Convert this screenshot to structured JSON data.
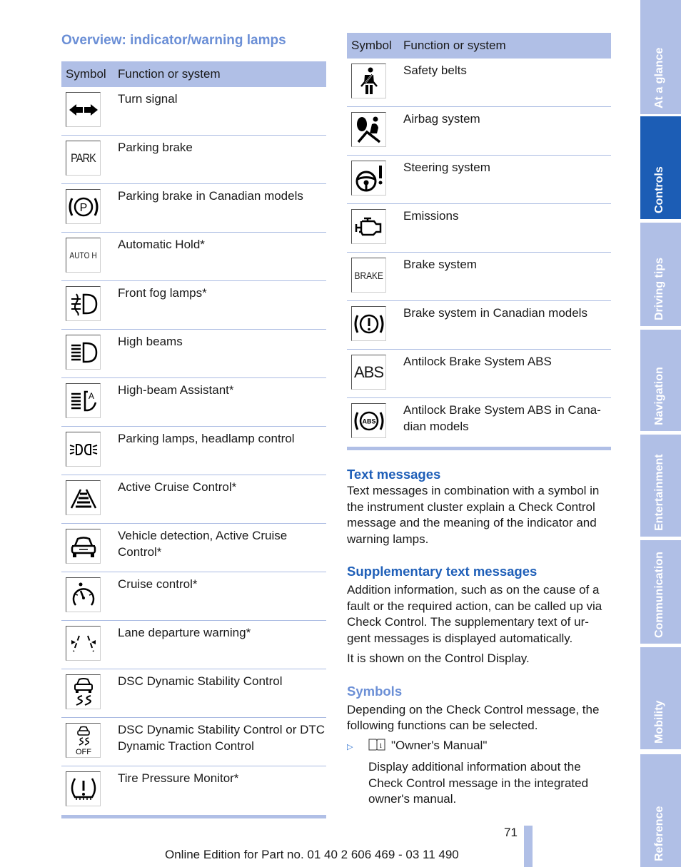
{
  "left_section": {
    "title": "Overview: indicator/warning lamps",
    "table_header": {
      "symbol": "Symbol",
      "function": "Function or system"
    },
    "rows": [
      {
        "icon": "turn-signal-icon",
        "label": "Turn signal"
      },
      {
        "icon": "park-text-icon",
        "icon_text": "PARK",
        "label": "Parking brake"
      },
      {
        "icon": "parking-brake-canada-icon",
        "label": "Parking brake in Canadian models"
      },
      {
        "icon": "auto-hold-icon",
        "icon_text": "AUTO H",
        "label": "Automatic Hold*"
      },
      {
        "icon": "front-fog-lamp-icon",
        "label": "Front fog lamps*"
      },
      {
        "icon": "high-beam-icon",
        "label": "High beams"
      },
      {
        "icon": "high-beam-assistant-icon",
        "label": "High-beam Assistant*"
      },
      {
        "icon": "parking-lamps-icon",
        "label": "Parking lamps, headlamp control"
      },
      {
        "icon": "active-cruise-control-icon",
        "label": "Active Cruise Control*"
      },
      {
        "icon": "vehicle-detection-icon",
        "label": "Vehicle detection, Active Cruise Control*"
      },
      {
        "icon": "cruise-control-icon",
        "label": "Cruise control*"
      },
      {
        "icon": "lane-departure-icon",
        "label": "Lane departure warning*"
      },
      {
        "icon": "dsc-icon",
        "label": "DSC Dynamic Stability Control"
      },
      {
        "icon": "dsc-off-icon",
        "icon_text": "OFF",
        "label": "DSC Dynamic Stability Control or DTC Dynamic Traction Control"
      },
      {
        "icon": "tire-pressure-icon",
        "label": "Tire Pressure Monitor*"
      }
    ]
  },
  "right_section": {
    "table_header": {
      "symbol": "Symbol",
      "function": "Function or system"
    },
    "rows": [
      {
        "icon": "safety-belt-icon",
        "label": "Safety belts"
      },
      {
        "icon": "airbag-icon",
        "label": "Airbag system"
      },
      {
        "icon": "steering-system-icon",
        "label": "Steering system"
      },
      {
        "icon": "emissions-icon",
        "label": "Emissions"
      },
      {
        "icon": "brake-text-icon",
        "icon_text": "BRAKE",
        "label": "Brake system"
      },
      {
        "icon": "brake-canada-icon",
        "label": "Brake system in Canadian models"
      },
      {
        "icon": "abs-text-icon",
        "icon_text": "ABS",
        "label": "Antilock Brake System ABS"
      },
      {
        "icon": "abs-canada-icon",
        "icon_text": "ABS",
        "label": "Antilock Brake System ABS in Cana-dian models"
      }
    ],
    "text_messages": {
      "title": "Text messages",
      "body": "Text messages in combination with a symbol in the instrument cluster explain a Check Control message and the meaning of the indicator and warning lamps."
    },
    "supplementary": {
      "title": "Supplementary text messages",
      "body": "Addition information, such as on the cause of a fault or the required action, can be called up via Check Control. The supplementary text of ur-gent messages is displayed automatically.",
      "body2": "It is shown on the Control Display."
    },
    "symbols": {
      "title": "Symbols",
      "body": "Depending on the Check Control message, the following functions can be selected.",
      "bullet_label": "\"Owner's Manual\"",
      "bullet_icon": "owners-manual-icon",
      "bullet_desc": "Display additional information about the Check Control message in the integrated owner's manual."
    }
  },
  "sidebar": {
    "tabs": [
      {
        "label": "At a glance",
        "active": false
      },
      {
        "label": "Controls",
        "active": true
      },
      {
        "label": "Driving tips",
        "active": false
      },
      {
        "label": "Navigation",
        "active": false
      },
      {
        "label": "Entertainment",
        "active": false
      },
      {
        "label": "Communication",
        "active": false
      },
      {
        "label": "Mobility",
        "active": false
      },
      {
        "label": "Reference",
        "active": false
      }
    ]
  },
  "footer": {
    "page_number": "71",
    "edition": "Online Edition for Part no. 01 40 2 606 469 - 03 11 490"
  },
  "colors": {
    "accent_blue": "#1f5fb8",
    "light_blue_heading": "#6b8fd6",
    "table_header_bg": "#b0bfe6",
    "sidebar_active": "#1c5db5"
  }
}
